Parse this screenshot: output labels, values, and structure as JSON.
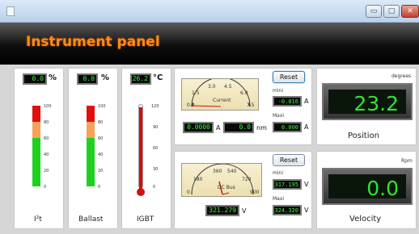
{
  "window": {
    "buttons": {
      "minimize": "▭",
      "maximize": "□",
      "close": "✕"
    }
  },
  "header": {
    "title": "Instrument panel"
  },
  "bars": [
    {
      "value": "0.0",
      "unit": "%",
      "label": "I²t",
      "scale": [
        "100",
        "80",
        "60",
        "40",
        "20",
        "0"
      ]
    },
    {
      "value": "0.0",
      "unit": "%",
      "label": "Ballast",
      "scale": [
        "100",
        "80",
        "60",
        "40",
        "20",
        "0"
      ]
    },
    {
      "value": "26.2",
      "unit": "°C",
      "label": "IGBT",
      "scale": [
        "120",
        "90",
        "60",
        "30",
        "0"
      ]
    }
  ],
  "current": {
    "meter_label": "Current",
    "scale": [
      "0.0",
      "1.5",
      "3.0",
      "4.5",
      "6.0",
      "7.5"
    ],
    "reset_label": "Reset",
    "mini_label": "mini",
    "mini_value": "-0.016",
    "mini_unit": "A",
    "maxi_label": "Maxi",
    "maxi_value": "0.000",
    "maxi_unit": "A",
    "value_a": "0.0000",
    "value_a_unit": "A",
    "value_nm": "0.0",
    "value_nm_unit": "nm"
  },
  "dcbus": {
    "meter_label": "DC Bus",
    "scale": [
      "0",
      "180",
      "360",
      "540",
      "720",
      "900"
    ],
    "reset_label": "Reset",
    "mini_label": "mini",
    "mini_value": "317.195",
    "mini_unit": "V",
    "maxi_label": "Maxi",
    "maxi_value": "324.320",
    "maxi_unit": "V",
    "value": "321.279",
    "value_unit": "V"
  },
  "position": {
    "unit": "degrees",
    "value": "23.2",
    "label": "Position"
  },
  "velocity": {
    "unit": "Rpm",
    "value": "0.0",
    "label": "Velocity"
  },
  "colors": {
    "header_text": "#ff8a16",
    "lcd_text": "#3cf03c",
    "bar_red": "#e01010",
    "bar_orange": "#f5a25a",
    "bar_green": "#20d020"
  }
}
